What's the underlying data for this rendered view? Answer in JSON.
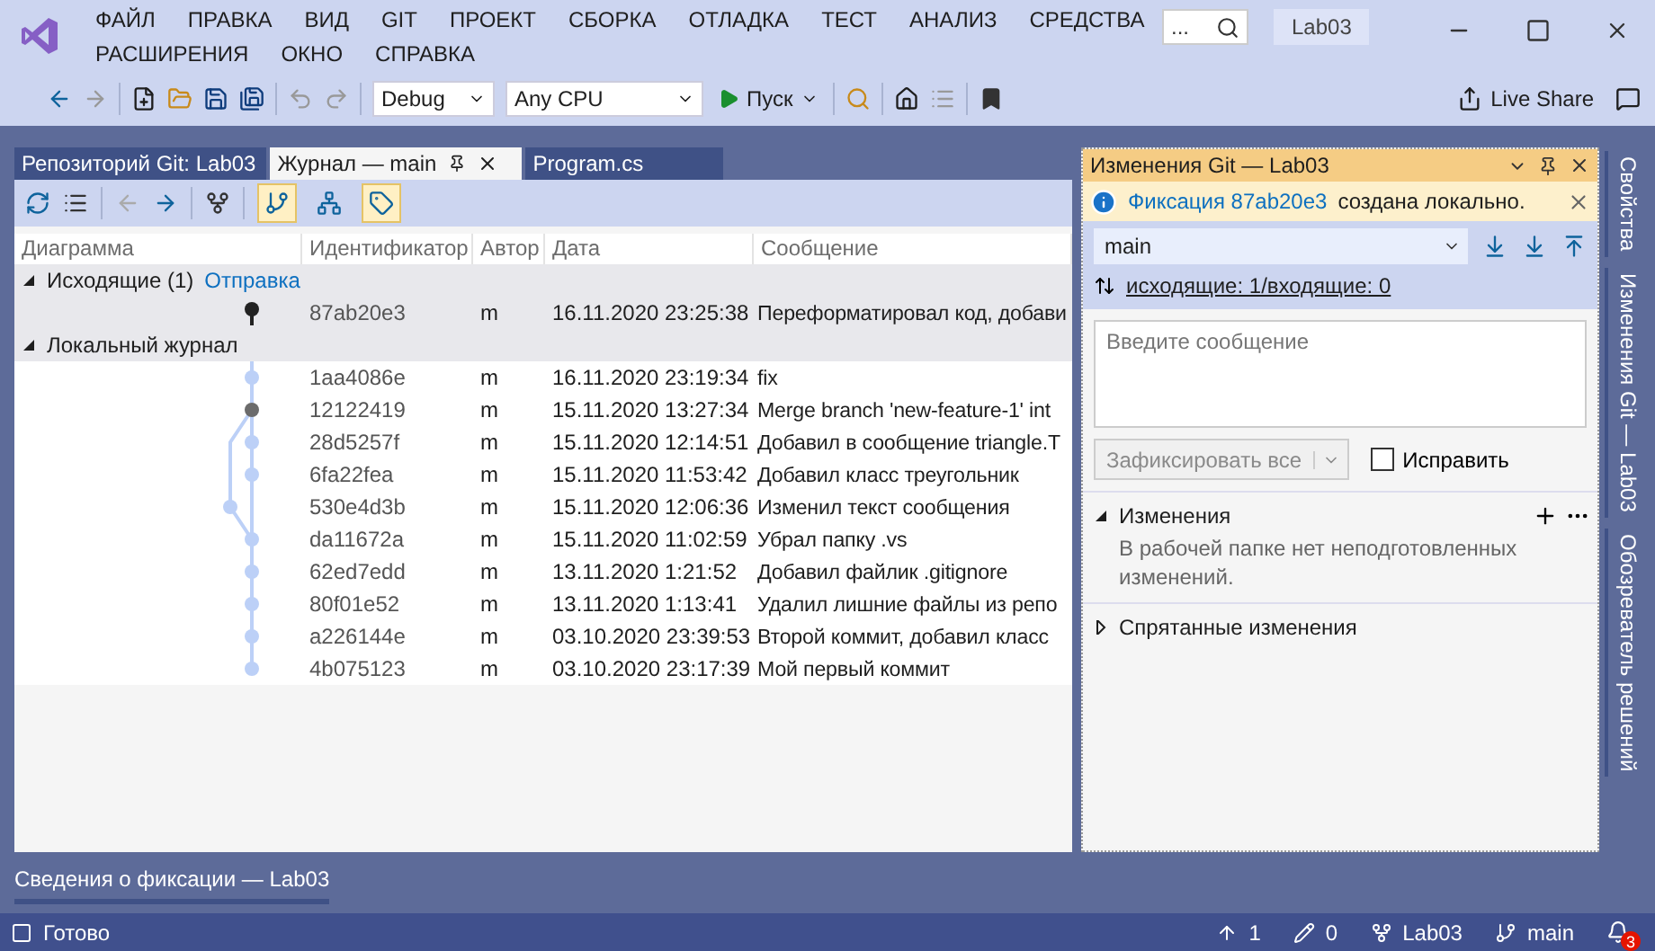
{
  "menu_rows": [
    [
      "ФАЙЛ",
      "ПРАВКА",
      "ВИД",
      "GIT",
      "ПРОЕКТ",
      "СБОРКА",
      "ОТЛАДКА",
      "ТЕСТ",
      "АНАЛИЗ",
      "СРЕДСТВА"
    ],
    [
      "РАСШИРЕНИЯ",
      "ОКНО",
      "СПРАВКА"
    ]
  ],
  "search": {
    "placeholder": "..."
  },
  "solution_badge": "Lab03",
  "toolbar": {
    "configuration": "Debug",
    "platform": "Any CPU",
    "run": "Пуск",
    "live_share": "Live Share"
  },
  "doc_tabs": [
    {
      "label": "Репозиторий Git: Lab03",
      "selected": false
    },
    {
      "label": "Журнал — main",
      "selected": true
    },
    {
      "label": "Program.cs",
      "selected": false
    }
  ],
  "view_toggles": [
    {
      "kind": "branches",
      "on": true
    },
    {
      "kind": "remote",
      "on": false
    },
    {
      "kind": "tags",
      "on": true
    }
  ],
  "columns": [
    "Диаграмма",
    "Идентификатор",
    "Автор",
    "Дата",
    "Сообщение"
  ],
  "outgoing": {
    "label": "Исходящие (1)",
    "link": "Отправка",
    "expanded": true,
    "rows": [
      {
        "id": "87ab20e3",
        "author": "m",
        "date": "16.11.2020 23:25:38",
        "message": "Переформатировал код, добави",
        "selected": true
      }
    ]
  },
  "local": {
    "label": "Локальный журнал",
    "expanded": true,
    "rows": [
      {
        "kind": "commit",
        "id": "1aa4086e",
        "author": "m",
        "date": "16.11.2020 23:19:34",
        "message": "fix",
        "selected": false
      },
      {
        "kind": "merge",
        "id": "12122419",
        "author": "m",
        "date": "15.11.2020 13:27:34",
        "message": "Merge branch 'new-feature-1' int",
        "selected": false
      },
      {
        "kind": "commit",
        "id": "28d5257f",
        "author": "m",
        "date": "15.11.2020 12:14:51",
        "message": "Добавил в сообщение triangle.T",
        "selected": false
      },
      {
        "kind": "commit",
        "id": "6fa22fea",
        "author": "m",
        "date": "15.11.2020 11:53:42",
        "message": "Добавил класс треугольник",
        "selected": false
      },
      {
        "kind": "side",
        "id": "530e4d3b",
        "author": "m",
        "date": "15.11.2020 12:06:36",
        "message": "Изменил текст сообщения",
        "selected": false
      },
      {
        "kind": "commit",
        "id": "da11672a",
        "author": "m",
        "date": "15.11.2020 11:02:59",
        "message": "Убрал папку .vs",
        "selected": false
      },
      {
        "kind": "commit",
        "id": "62ed7edd",
        "author": "m",
        "date": "13.11.2020 1:21:52",
        "message": "Добавил файлик .gitignore",
        "selected": false
      },
      {
        "kind": "commit",
        "id": "80f01e52",
        "author": "m",
        "date": "13.11.2020 1:13:41",
        "message": "Удалил лишние файлы из репо",
        "selected": false
      },
      {
        "kind": "commit",
        "id": "a226144e",
        "author": "m",
        "date": "03.10.2020 23:39:53",
        "message": "Второй коммит, добавил класс",
        "selected": false
      },
      {
        "kind": "commit",
        "id": "4b075123",
        "author": "m",
        "date": "03.10.2020 23:17:39",
        "message": "Мой первый коммит",
        "selected": false
      }
    ]
  },
  "git_panel": {
    "title": "Изменения Git — Lab03",
    "notice_link": "Фиксация 87ab20e3",
    "notice_text": "создана локально.",
    "branch": "main",
    "sync_link": "исходящие: 1/входящие: 0",
    "message_placeholder": "Введите сообщение",
    "commit_button": "Зафиксировать все",
    "commit_disabled": true,
    "amend": {
      "label": "Исправить",
      "checked": false
    },
    "sections": [
      {
        "label": "Изменения",
        "expanded": true,
        "text": "В рабочей папке нет неподготовленных изменений.",
        "actions": true
      },
      {
        "label": "Спрятанные изменения",
        "expanded": false
      }
    ]
  },
  "side_tabs": [
    "Свойства",
    "Изменения Git — Lab03",
    "Обозреватель решений"
  ],
  "bottom_tab": "Сведения о фиксации — Lab03",
  "status_bar": {
    "text": "Готово",
    "outgoing": "1",
    "changes": "0",
    "repo": "Lab03",
    "branch": "main",
    "notifications": "3"
  }
}
